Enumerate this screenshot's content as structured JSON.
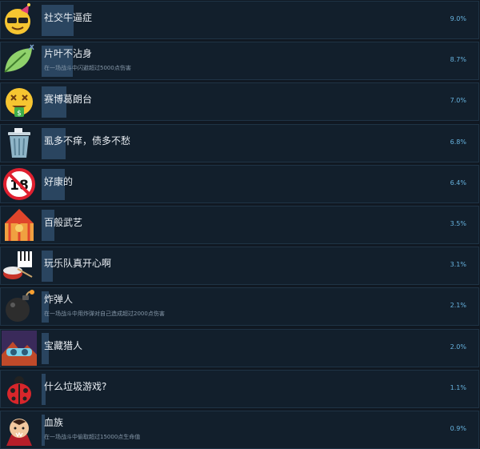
{
  "achievements": [
    {
      "name": "社交牛逼症",
      "desc": "",
      "percent": "9.0%",
      "rate": 0.09,
      "icon": "party-sunglasses-icon"
    },
    {
      "name": "片叶不沾身",
      "desc": "在一场战斗中闪避超过5000点伤害",
      "percent": "8.7%",
      "rate": 0.087,
      "icon": "leaf-icon"
    },
    {
      "name": "赛博葛朗台",
      "desc": "",
      "percent": "7.0%",
      "rate": 0.07,
      "icon": "money-face-icon"
    },
    {
      "name": "虱多不痒，债多不愁",
      "desc": "",
      "percent": "6.8%",
      "rate": 0.068,
      "icon": "trash-can-icon"
    },
    {
      "name": "好康的",
      "desc": "",
      "percent": "6.4%",
      "rate": 0.064,
      "icon": "no-under-18-icon"
    },
    {
      "name": "百般武艺",
      "desc": "",
      "percent": "3.5%",
      "rate": 0.035,
      "icon": "circus-tent-icon"
    },
    {
      "name": "玩乐队真开心啊",
      "desc": "",
      "percent": "3.1%",
      "rate": 0.031,
      "icon": "drum-and-keys-icon"
    },
    {
      "name": "炸弹人",
      "desc": "在一场战斗中用炸弹对自己造成超过2000点伤害",
      "percent": "2.1%",
      "rate": 0.021,
      "icon": "bomb-icon"
    },
    {
      "name": "宝藏猎人",
      "desc": "",
      "percent": "2.0%",
      "rate": 0.02,
      "icon": "treasure-goggles-icon"
    },
    {
      "name": "什么垃圾游戏?",
      "desc": "",
      "percent": "1.1%",
      "rate": 0.011,
      "icon": "ladybug-icon"
    },
    {
      "name": "血族",
      "desc": "在一场战斗中偷取超过15000点生命值",
      "percent": "0.9%",
      "rate": 0.009,
      "icon": "vampire-icon"
    }
  ]
}
